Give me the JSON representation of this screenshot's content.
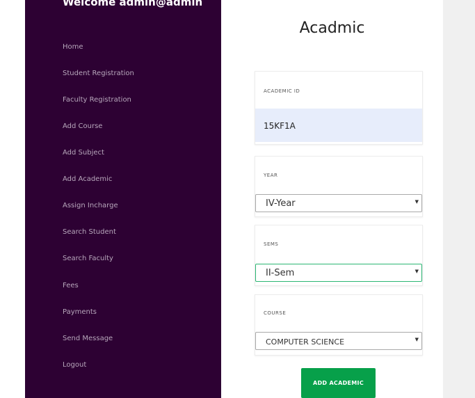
{
  "sidebar": {
    "welcome": "Welcome admin@admin",
    "items": [
      {
        "label": "Home"
      },
      {
        "label": "Student Registration"
      },
      {
        "label": "Faculty Registration"
      },
      {
        "label": "Add Course"
      },
      {
        "label": "Add Subject"
      },
      {
        "label": "Add Academic"
      },
      {
        "label": "Assign Incharge"
      },
      {
        "label": "Search Student"
      },
      {
        "label": "Search Faculty"
      },
      {
        "label": "Fees"
      },
      {
        "label": "Payments"
      },
      {
        "label": "Send Message"
      },
      {
        "label": "Logout"
      }
    ]
  },
  "main": {
    "title": "Acadmic",
    "academic_id": {
      "label": "ACADEMIC ID",
      "value": "15KF1A"
    },
    "year": {
      "label": "YEAR",
      "value": "IV-Year"
    },
    "sems": {
      "label": "SEMS",
      "value": "II-Sem"
    },
    "course": {
      "label": "COURSE",
      "value": "COMPUTER SCIENCE"
    },
    "submit_label": "ADD ACADEMIC"
  },
  "colors": {
    "sidebar_bg": "#2d0133",
    "button_bg": "#07a04a",
    "focus_border": "#2bb673",
    "id_field_bg": "#e7edfb"
  }
}
